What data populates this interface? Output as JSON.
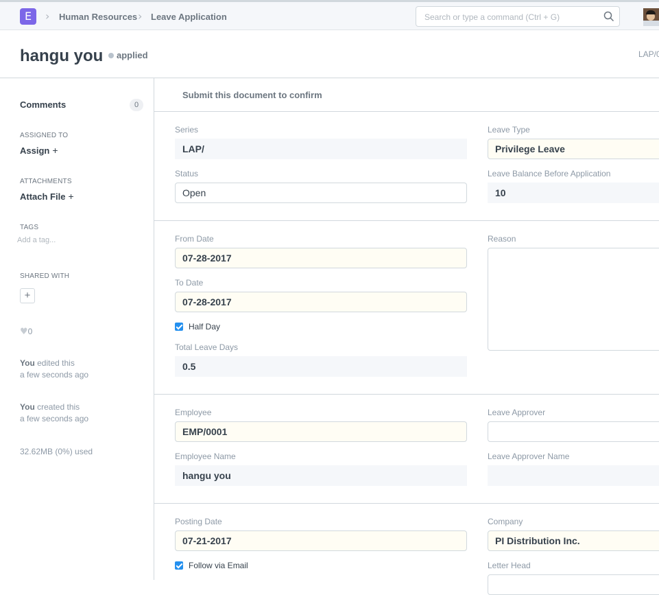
{
  "navbar": {
    "logo_letter": "E",
    "breadcrumbs": [
      "Human Resources",
      "Leave Application"
    ],
    "search_placeholder": "Search or type a command (Ctrl + G)"
  },
  "page": {
    "title": "hangu you",
    "status": "applied",
    "doc_name": "LAP/0"
  },
  "sidebar": {
    "comments_label": "Comments",
    "comments_count": "0",
    "assigned_to_label": "ASSIGNED TO",
    "assign_label": "Assign",
    "attachments_label": "ATTACHMENTS",
    "attach_label": "Attach File",
    "tags_label": "TAGS",
    "tag_placeholder": "Add a tag...",
    "shared_with_label": "SHARED WITH",
    "likes": "0",
    "timeline": [
      {
        "user": "You",
        "action": "edited this",
        "when": "a few seconds ago"
      },
      {
        "user": "You",
        "action": "created this",
        "when": "a few seconds ago"
      }
    ],
    "usage": "32.62MB (0%) used"
  },
  "form": {
    "message": "Submit this document to confirm",
    "series_label": "Series",
    "series": "LAP/",
    "status_label": "Status",
    "status": "Open",
    "leave_type_label": "Leave Type",
    "leave_type": "Privilege Leave",
    "balance_label": "Leave Balance Before Application",
    "balance": "10",
    "from_date_label": "From Date",
    "from_date": "07-28-2017",
    "to_date_label": "To Date",
    "to_date": "07-28-2017",
    "half_day_label": "Half Day",
    "half_day": true,
    "total_days_label": "Total Leave Days",
    "total_days": "0.5",
    "reason_label": "Reason",
    "employee_label": "Employee",
    "employee": "EMP/0001",
    "employee_name_label": "Employee Name",
    "employee_name": "hangu you",
    "approver_label": "Leave Approver",
    "approver_name_label": "Leave Approver Name",
    "posting_date_label": "Posting Date",
    "posting_date": "07-21-2017",
    "follow_label": "Follow via Email",
    "follow": true,
    "company_label": "Company",
    "company": "PI Distribution Inc.",
    "letter_head_label": "Letter Head"
  },
  "colors": {
    "brand": "#7c67e8",
    "checkbox": "#2490ef",
    "required_bg": "#fffdf4",
    "readonly_bg": "#f5f7fa"
  }
}
